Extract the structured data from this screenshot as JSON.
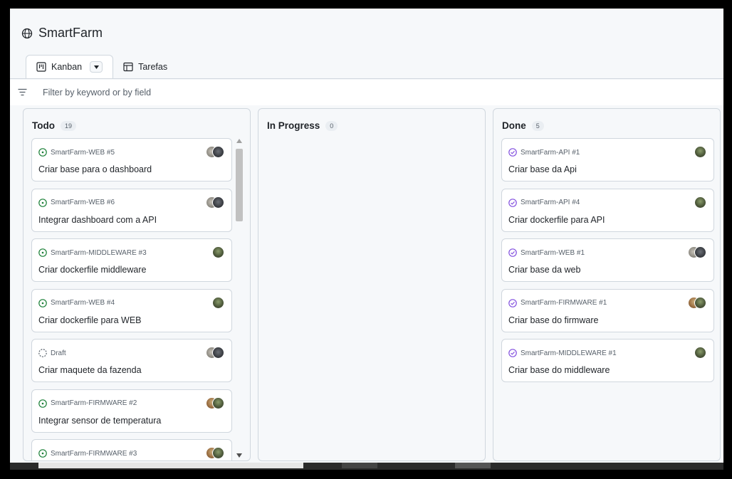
{
  "app": {
    "title": "SmartFarm"
  },
  "tabs": [
    {
      "label": "Kanban",
      "active": true
    },
    {
      "label": "Tarefas",
      "active": false
    }
  ],
  "filter": {
    "placeholder": "Filter by keyword or by field"
  },
  "columns": [
    {
      "name": "Todo",
      "count": "19",
      "cards": [
        {
          "ref": "SmartFarm-WEB #5",
          "title": "Criar base para o dashboard",
          "status": "open",
          "avatars": [
            "a2",
            "a4"
          ]
        },
        {
          "ref": "SmartFarm-WEB #6",
          "title": "Integrar dashboard com a API",
          "status": "open",
          "avatars": [
            "a2",
            "a4"
          ]
        },
        {
          "ref": "SmartFarm-MIDDLEWARE #3",
          "title": "Criar dockerfile middleware",
          "status": "open",
          "avatars": [
            "a1"
          ]
        },
        {
          "ref": "SmartFarm-WEB #4",
          "title": "Criar dockerfile para WEB",
          "status": "open",
          "avatars": [
            "a1"
          ]
        },
        {
          "ref": "Draft",
          "title": "Criar maquete da fazenda",
          "status": "draft",
          "avatars": [
            "a2",
            "a4"
          ]
        },
        {
          "ref": "SmartFarm-FIRMWARE #2",
          "title": "Integrar sensor de temperatura",
          "status": "open",
          "avatars": [
            "a3",
            "a1"
          ]
        },
        {
          "ref": "SmartFarm-FIRMWARE #3",
          "title": "",
          "status": "open",
          "avatars": [
            "a3",
            "a1"
          ]
        }
      ]
    },
    {
      "name": "In Progress",
      "count": "0",
      "cards": []
    },
    {
      "name": "Done",
      "count": "5",
      "cards": [
        {
          "ref": "SmartFarm-API #1",
          "title": "Criar base da Api",
          "status": "done",
          "avatars": [
            "a1"
          ]
        },
        {
          "ref": "SmartFarm-API #4",
          "title": "Criar dockerfile para API",
          "status": "done",
          "avatars": [
            "a1"
          ]
        },
        {
          "ref": "SmartFarm-WEB #1",
          "title": "Criar base da web",
          "status": "done",
          "avatars": [
            "a2",
            "a4"
          ]
        },
        {
          "ref": "SmartFarm-FIRMWARE #1",
          "title": "Criar base do firmware",
          "status": "done",
          "avatars": [
            "a3",
            "a1"
          ]
        },
        {
          "ref": "SmartFarm-MIDDLEWARE #1",
          "title": "Criar base do middleware",
          "status": "done",
          "avatars": [
            "a1"
          ]
        }
      ]
    }
  ],
  "colors": {
    "open": "#1a7f37",
    "done": "#8250df",
    "draft": "#57606a"
  },
  "icons": {
    "header": "globe-icon",
    "kanban_tab": "project-board-icon",
    "table_tab": "table-icon",
    "filter": "filter-icon",
    "open_issue": "issue-open-icon",
    "closed_issue": "issue-closed-icon",
    "draft_issue": "issue-draft-icon"
  }
}
